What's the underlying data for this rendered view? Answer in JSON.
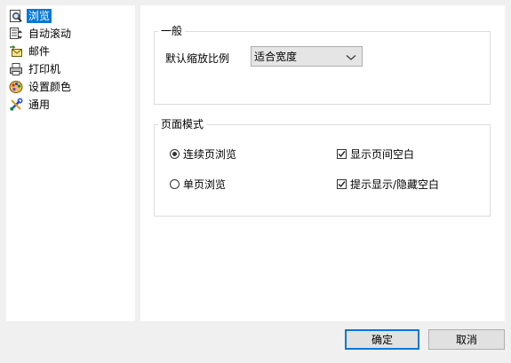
{
  "sidebar": {
    "items": [
      {
        "label": "浏览",
        "icon": "magnifier-page-icon"
      },
      {
        "label": "自动滚动",
        "icon": "auto-scroll-icon"
      },
      {
        "label": "邮件",
        "icon": "mail-icon"
      },
      {
        "label": "打印机",
        "icon": "printer-icon"
      },
      {
        "label": "设置颜色",
        "icon": "color-palette-icon"
      },
      {
        "label": "通用",
        "icon": "tools-icon"
      }
    ],
    "selected_index": 0
  },
  "general_group": {
    "title": "一般",
    "zoom_label": "默认缩放比例",
    "zoom_value": "适合宽度"
  },
  "page_mode_group": {
    "title": "页面模式",
    "continuous_label": "连续页浏览",
    "single_label": "单页浏览",
    "show_gap_label": "显示页间空白",
    "toggle_gap_label": "提示显示/隐藏空白",
    "selected_mode": "continuous",
    "show_gap_checked": true,
    "toggle_gap_checked": true
  },
  "buttons": {
    "ok": "确定",
    "cancel": "取消"
  },
  "colors": {
    "selection": "#0078d7",
    "panel": "#ffffff",
    "window": "#f0f0f0"
  }
}
